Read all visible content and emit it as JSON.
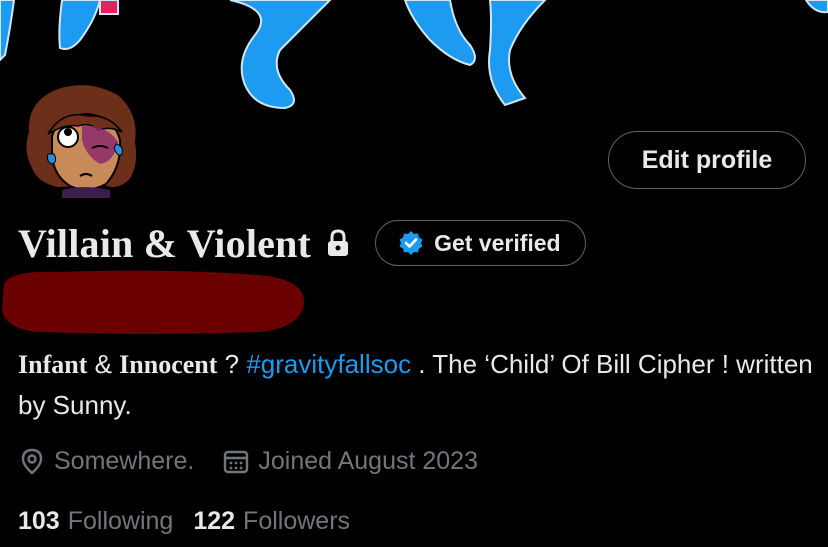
{
  "profile": {
    "display_name": "Villain & Violent",
    "edit_profile_label": "Edit profile",
    "get_verified_label": "Get verified",
    "bio": {
      "part1": "Infant",
      "part2": " & ",
      "part3": "Innocent",
      "part4": " ? ",
      "hashtag": "#gravityfallsoc",
      "part5": " . The ‘Child’ Of Bill Cipher ! written by Sunny."
    },
    "location": "Somewhere.",
    "joined": "Joined August 2023",
    "following_count": "103",
    "following_label": "Following",
    "followers_count": "122",
    "followers_label": "Followers"
  },
  "colors": {
    "background": "#000000",
    "text": "#e7e9ea",
    "secondary_text": "#71767b",
    "link": "#1d9bf0",
    "border": "#536471",
    "redaction": "#6b0000",
    "banner_figure": "#1d9bf0"
  },
  "icons": {
    "lock": "lock-icon",
    "verified": "verified-badge-icon",
    "location": "location-pin-icon",
    "calendar": "calendar-icon"
  }
}
